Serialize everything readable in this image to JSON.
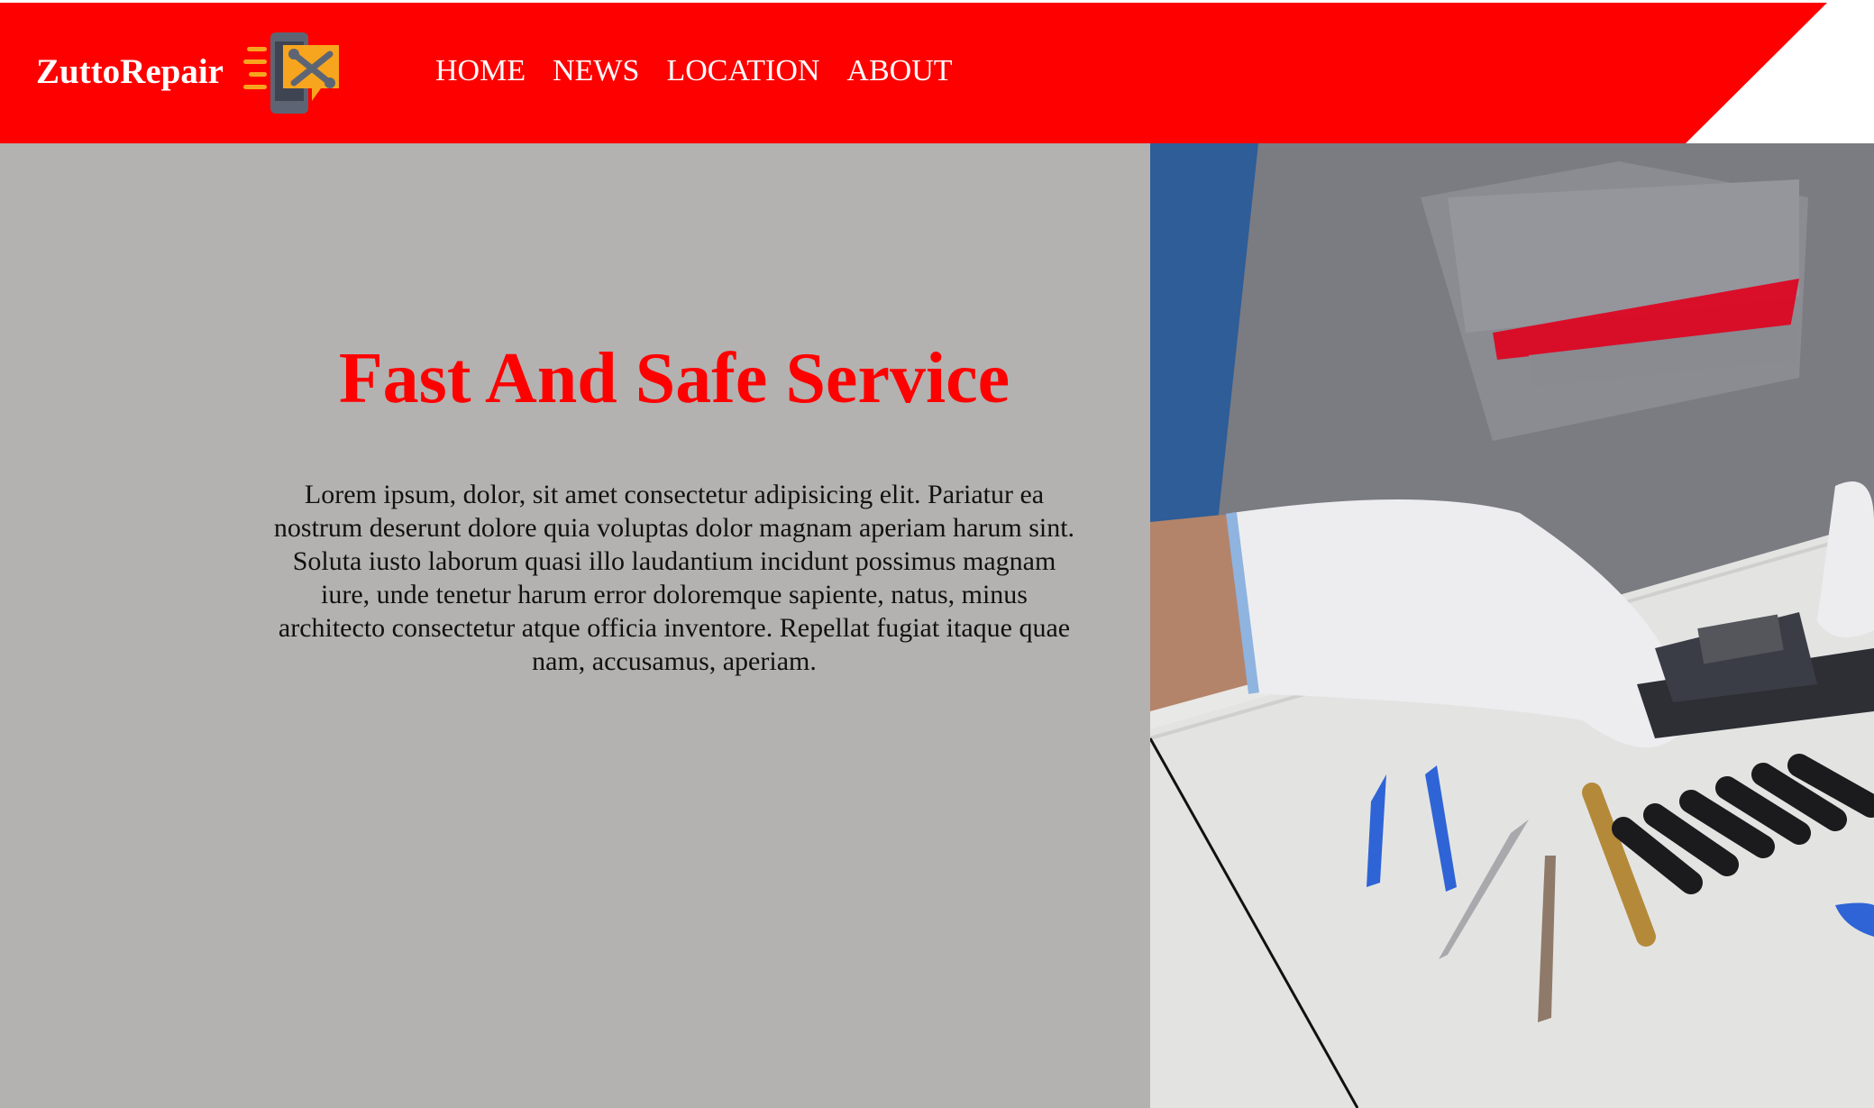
{
  "brand": {
    "name": "ZuttoRepair",
    "logo_icon": "phone-repair-tools-icon"
  },
  "nav": {
    "items": [
      {
        "label": "HOME"
      },
      {
        "label": "NEWS"
      },
      {
        "label": "LOCATION"
      },
      {
        "label": "ABOUT"
      }
    ]
  },
  "hero": {
    "title": "Fast And Safe Service",
    "body": "Lorem ipsum, dolor, sit amet consectetur adipisicing elit. Pariatur ea nostrum deserunt dolore quia voluptas dolor magnam aperiam harum sint. Soluta iusto laborum quasi illo laudantium incidunt possimus magnam iure, unde tenetur harum error doloremque sapiente, natus, minus architecto consectetur atque officia inventore. Repellat fugiat itaque quae nam, accusamus, aperiam.",
    "photo_icon": "technician-repairing-phone-photo"
  },
  "colors": {
    "header": "#ff0000",
    "panel": "#b3b2b1",
    "title": "#ff0000",
    "logo_accent": "#f7a51e"
  }
}
